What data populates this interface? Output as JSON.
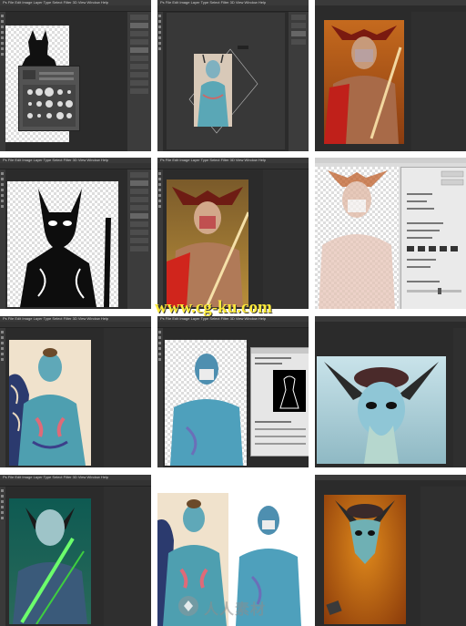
{
  "page": {
    "title": ""
  },
  "menubar_text": "Ps  File  Edit  Image  Layer  Type  Select  Filter  3D  View  Window  Help",
  "watermark": {
    "text": "www.cg-ku.com"
  },
  "logo": {
    "text": "人人素材"
  },
  "tiles": [
    {
      "id": "tile-1",
      "content": "silhouette-brush-picker"
    },
    {
      "id": "tile-2",
      "content": "transform-photo"
    },
    {
      "id": "tile-3",
      "content": "warrior-painting"
    },
    {
      "id": "tile-4",
      "content": "black-silhouette"
    },
    {
      "id": "tile-5",
      "content": "warrior-photo"
    },
    {
      "id": "tile-6",
      "content": "layer-style-dialog"
    },
    {
      "id": "tile-7",
      "content": "bodypaint-photo"
    },
    {
      "id": "tile-8",
      "content": "mask-dialog"
    },
    {
      "id": "tile-9",
      "content": "closeup-creature"
    },
    {
      "id": "tile-10",
      "content": "green-glow-creature"
    },
    {
      "id": "tile-11",
      "content": "comparison-photos"
    },
    {
      "id": "tile-12",
      "content": "orange-creature"
    }
  ],
  "colors": {
    "ps_bg": "#2b2b2b",
    "panel": "#3c3c3c",
    "watermark": "#ffeb3b"
  }
}
